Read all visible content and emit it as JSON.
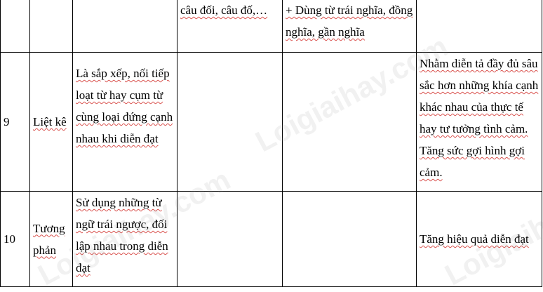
{
  "table": {
    "top_row": {
      "col4": "câu đối, câu đố,…",
      "col5": "+ Dùng từ trái nghĩa, đồng nghĩa, gần nghĩa"
    },
    "rows": [
      {
        "num": "9",
        "name": "Liệt kê",
        "definition": "Là sắp xếp, nối tiếp loạt từ hay cụm từ cùng loại đứng cạnh nhau khi diễn đạt",
        "effect": "Nhằm diễn tả đầy đủ sâu sắc hơn những khía cạnh khác nhau của thực tế hay tư tưởng tình cảm. Tăng sức gợi hình gợi cảm."
      },
      {
        "num": "10",
        "name": "Tương phản",
        "definition": "Sử dụng những từ ngữ trái ngược, đối lập nhau trong diễn đạt",
        "effect": "Tăng hiệu quả diễn đạt"
      }
    ]
  },
  "watermark": {
    "text": "Loigiaihay.com"
  }
}
